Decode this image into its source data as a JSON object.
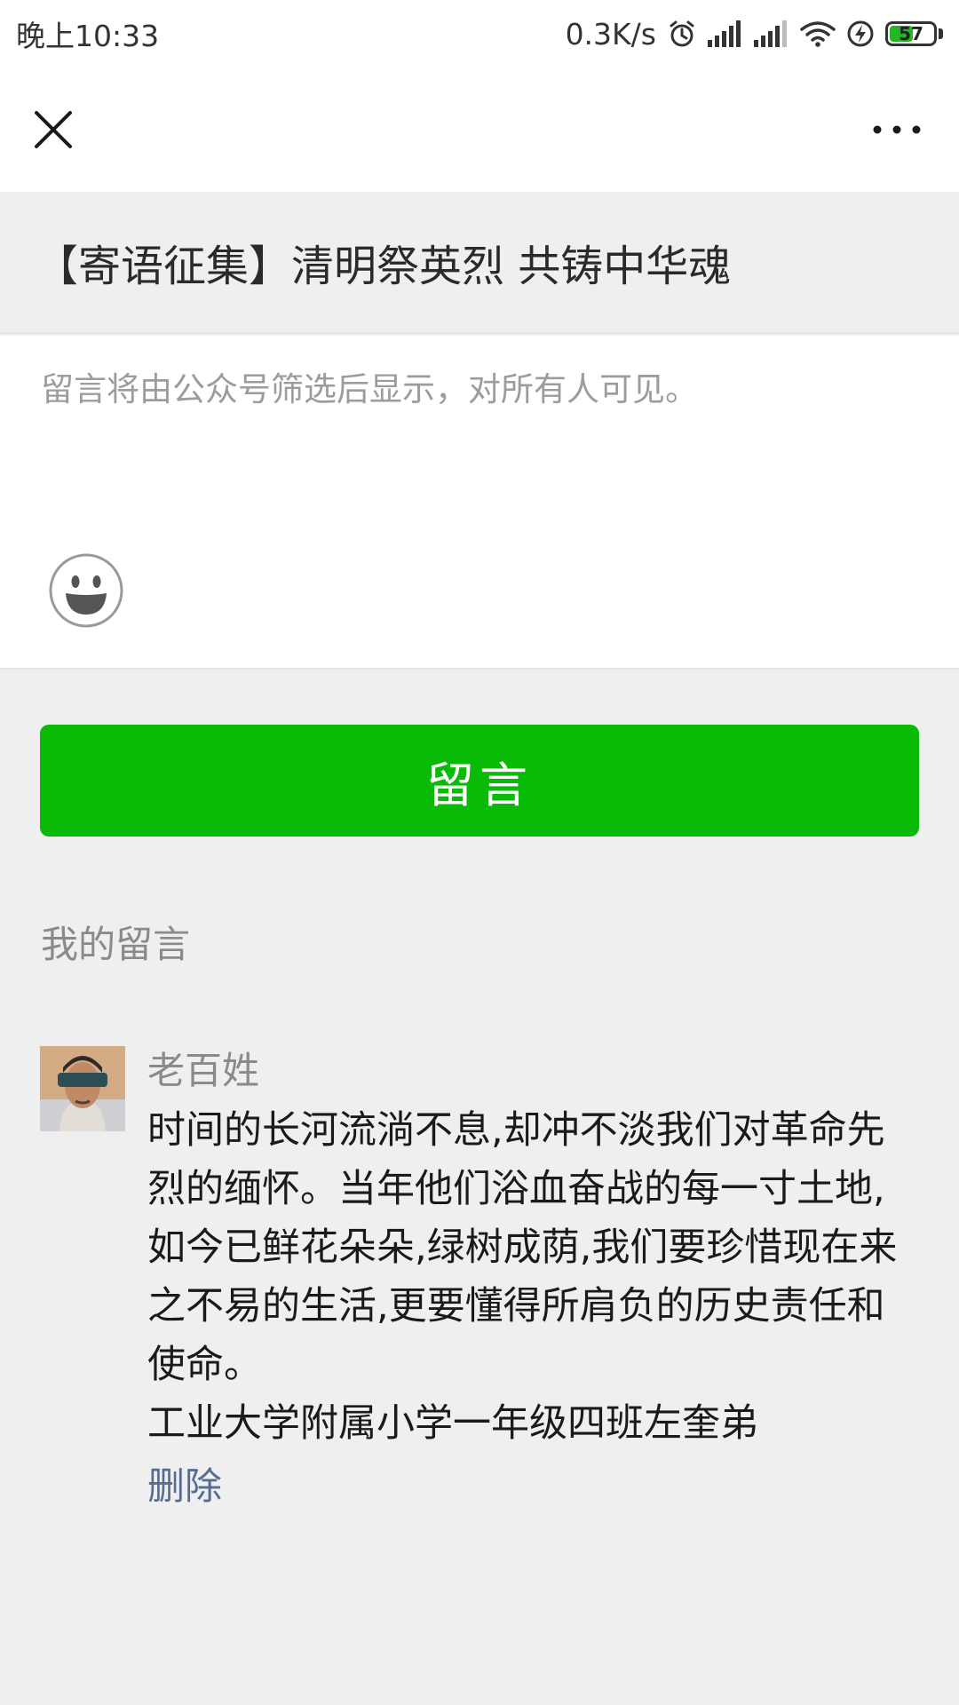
{
  "status_bar": {
    "time": "晚上10:33",
    "net_speed": "0.3K/s",
    "battery_level": "57",
    "battery_percent": 57,
    "icons": [
      "alarm-icon",
      "signal-icon",
      "signal-icon-2",
      "wifi-icon",
      "charging-icon",
      "battery-icon"
    ]
  },
  "nav": {
    "left_icon": "close-icon",
    "right_icon": "more-icon"
  },
  "article": {
    "title": "【寄语征集】清明祭英烈 共铸中华魂"
  },
  "comment_form": {
    "placeholder": "留言将由公众号筛选后显示，对所有人可见。",
    "emoji_icon": "emoji-icon",
    "submit_label": "留言",
    "submit_color": "#09bb07"
  },
  "my_comments": {
    "section_title": "我的留言",
    "items": [
      {
        "name": "老百姓",
        "text": "时间的长河流淌不息,却冲不淡我们对革命先烈的缅怀。当年他们浴血奋战的每一寸土地,如今已鲜花朵朵,绿树成荫,我们要珍惜现在来之不易的生活,更要懂得所肩负的历史责任和使命。",
        "signature": "工业大学附属小学一年级四班左奎弟",
        "delete_label": "删除",
        "link_color": "#576b95"
      }
    ]
  }
}
